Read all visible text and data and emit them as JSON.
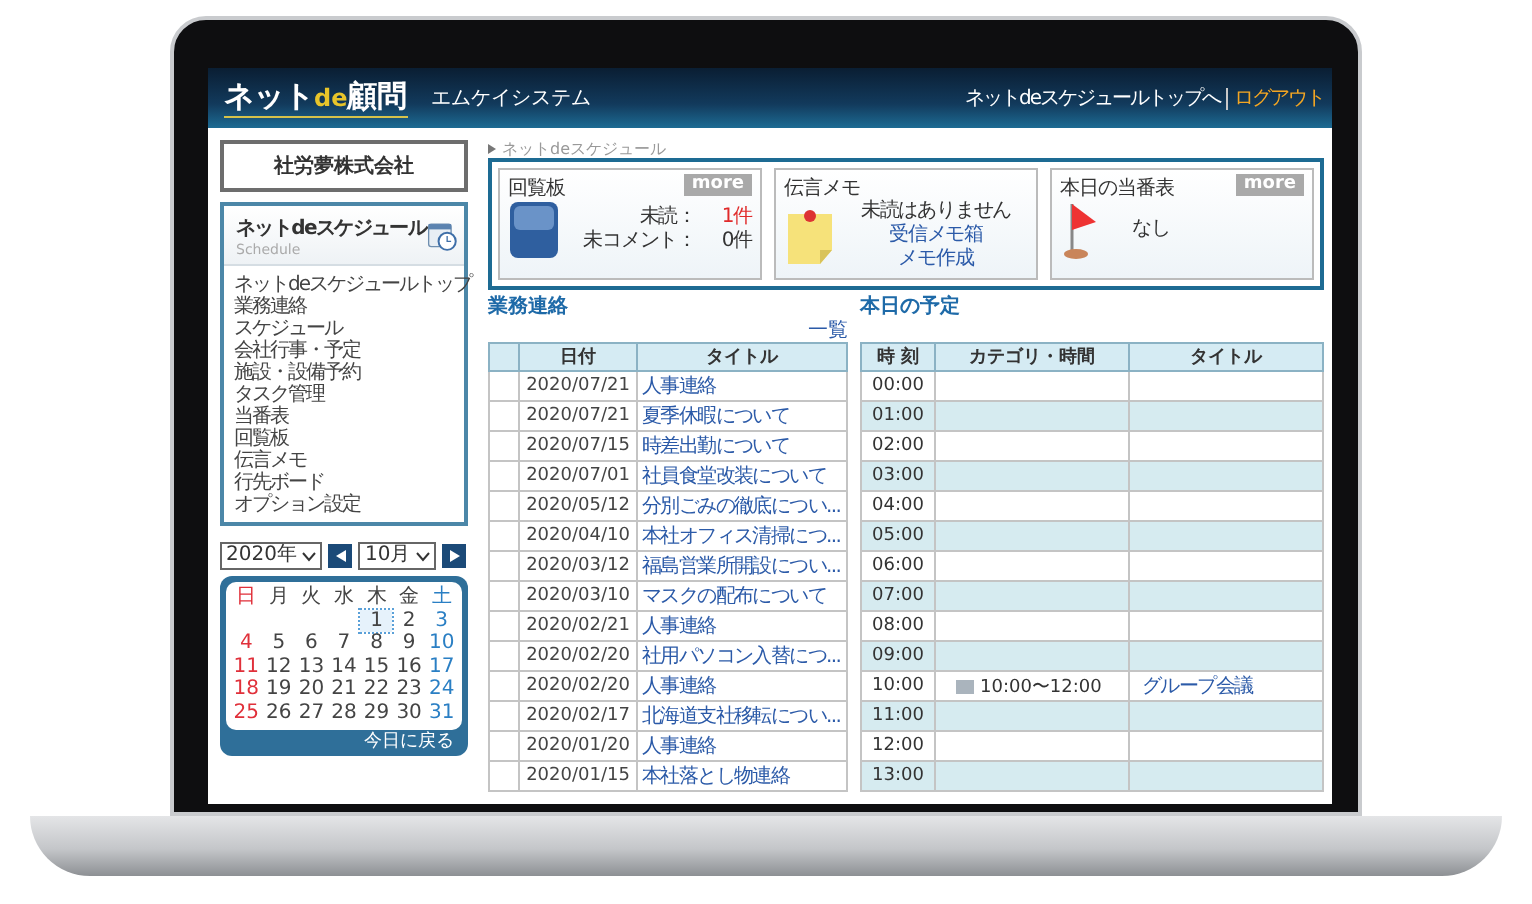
{
  "header": {
    "logo": [
      "ネット",
      "de",
      "顧問"
    ],
    "system_name": "エムケイシステム",
    "links": [
      "ネットdeスケジュールトップへ",
      "ログアウト"
    ]
  },
  "sidebar": {
    "company": "社労夢株式会社",
    "panel_title": "ネットdeスケジュール",
    "panel_subtitle": "Schedule",
    "items": [
      "ネットdeスケジュールトップ",
      "業務連絡",
      "スケジュール",
      "会社行事・予定",
      "施設・設備予約",
      "タスク管理",
      "当番表",
      "回覧板",
      "伝言メモ",
      "行先ボード",
      "オプション設定"
    ]
  },
  "calendar": {
    "year": "2020年",
    "month": "10月",
    "weekdays": [
      {
        "label": "日",
        "kind": "sunday"
      },
      {
        "label": "月",
        "kind": "weekday"
      },
      {
        "label": "火",
        "kind": "weekday"
      },
      {
        "label": "水",
        "kind": "weekday"
      },
      {
        "label": "木",
        "kind": "weekday"
      },
      {
        "label": "金",
        "kind": "weekday"
      },
      {
        "label": "土",
        "kind": "saturday"
      }
    ],
    "weeks": [
      [
        {
          "day": "1",
          "today": true
        },
        {
          "day": "2",
          "today": false
        },
        {
          "day": "3",
          "today": false
        }
      ],
      [
        {
          "day": "4",
          "today": false
        },
        {
          "day": "5",
          "today": false
        },
        {
          "day": "6",
          "today": false
        },
        {
          "day": "7",
          "today": false
        },
        {
          "day": "8",
          "today": false
        },
        {
          "day": "9",
          "today": false
        },
        {
          "day": "10",
          "today": false
        }
      ],
      [
        {
          "day": "11",
          "today": false
        },
        {
          "day": "12",
          "today": false
        },
        {
          "day": "13",
          "today": false
        },
        {
          "day": "14",
          "today": false
        },
        {
          "day": "15",
          "today": false
        },
        {
          "day": "16",
          "today": false
        },
        {
          "day": "17",
          "today": false
        }
      ],
      [
        {
          "day": "18",
          "today": false
        },
        {
          "day": "19",
          "today": false
        },
        {
          "day": "20",
          "today": false
        },
        {
          "day": "21",
          "today": false
        },
        {
          "day": "22",
          "today": false
        },
        {
          "day": "23",
          "today": false
        },
        {
          "day": "24",
          "today": false
        }
      ],
      [
        {
          "day": "25",
          "today": false
        },
        {
          "day": "26",
          "today": false
        },
        {
          "day": "27",
          "today": false
        },
        {
          "day": "28",
          "today": false
        },
        {
          "day": "29",
          "today": false
        },
        {
          "day": "30",
          "today": false
        },
        {
          "day": "31",
          "today": false
        }
      ]
    ],
    "footer_link": "今日に戻る"
  },
  "breadcrumb": "ネットdeスケジュール",
  "widgets": [
    {
      "kind": "circular",
      "title": "回覧板",
      "more": "more",
      "lines": [
        {
          "label": "未読：",
          "value": "1件",
          "alert": true
        },
        {
          "label": "未コメント：",
          "value": "0件",
          "alert": false
        }
      ]
    },
    {
      "kind": "memo",
      "title": "伝言メモ",
      "message": "未読はありません",
      "links": [
        "受信メモ箱",
        "メモ作成"
      ]
    },
    {
      "kind": "duty",
      "title": "本日の当番表",
      "more": "more",
      "message": "なし"
    }
  ],
  "notices": {
    "title": "業務連絡",
    "list_link": "一覧",
    "columns": [
      "日付",
      "タイトル"
    ],
    "rows": [
      {
        "date": "2020/07/21",
        "title": "人事連絡"
      },
      {
        "date": "2020/07/21",
        "title": "夏季休暇について"
      },
      {
        "date": "2020/07/15",
        "title": "時差出勤について"
      },
      {
        "date": "2020/07/01",
        "title": "社員食堂改装について"
      },
      {
        "date": "2020/05/12",
        "title": "分別ごみの徹底につい..."
      },
      {
        "date": "2020/04/10",
        "title": "本社オフィス清掃につ..."
      },
      {
        "date": "2020/03/12",
        "title": "福島営業所開設につい..."
      },
      {
        "date": "2020/03/10",
        "title": "マスクの配布について"
      },
      {
        "date": "2020/02/21",
        "title": "人事連絡"
      },
      {
        "date": "2020/02/20",
        "title": "社用パソコン入替につ..."
      },
      {
        "date": "2020/02/20",
        "title": "人事連絡"
      },
      {
        "date": "2020/02/17",
        "title": "北海道支社移転につい..."
      },
      {
        "date": "2020/01/20",
        "title": "人事連絡"
      },
      {
        "date": "2020/01/15",
        "title": "本社落とし物連絡"
      }
    ]
  },
  "today": {
    "title": "本日の予定",
    "columns": [
      "時 刻",
      "カテゴリ・時間",
      "タイトル"
    ],
    "rows": [
      {
        "time": "00:00"
      },
      {
        "time": "01:00"
      },
      {
        "time": "02:00"
      },
      {
        "time": "03:00"
      },
      {
        "time": "04:00"
      },
      {
        "time": "05:00"
      },
      {
        "time": "06:00"
      },
      {
        "time": "07:00"
      },
      {
        "time": "08:00"
      },
      {
        "time": "09:00"
      },
      {
        "time": "10:00",
        "category": "10:00〜12:00",
        "title": "グループ会議"
      },
      {
        "time": "11:00"
      },
      {
        "time": "12:00"
      },
      {
        "time": "13:00"
      }
    ]
  }
}
